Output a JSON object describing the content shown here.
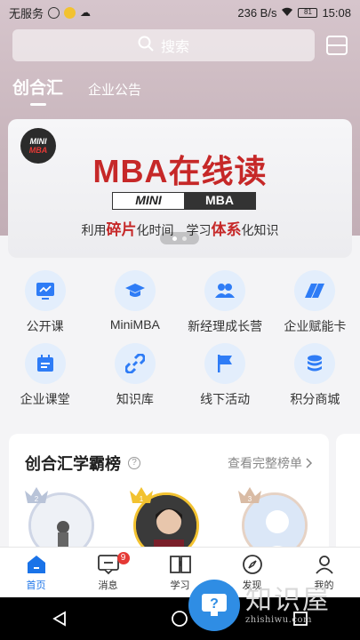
{
  "status_bar": {
    "carrier": "无服务",
    "speed": "236 B/s",
    "battery": "81",
    "time": "15:08"
  },
  "search": {
    "placeholder": "搜索"
  },
  "tabs": [
    {
      "label": "创合汇",
      "active": true
    },
    {
      "label": "企业公告",
      "active": false
    }
  ],
  "banner": {
    "logo_top": "MINI",
    "logo_bottom": "MBA",
    "title": "MBA在线读",
    "pill_left": "MINI",
    "pill_right": "MBA",
    "sub_1": "利用",
    "sub_2": "碎片",
    "sub_3": "化时间　学习",
    "sub_4": "体系",
    "sub_5": "化知识",
    "page_count": 2,
    "active_page": 1
  },
  "grid": [
    {
      "label": "公开课",
      "icon": "chart-screen-icon"
    },
    {
      "label": "MiniMBA",
      "icon": "graduation-cap-icon"
    },
    {
      "label": "新经理成长营",
      "icon": "people-icon"
    },
    {
      "label": "企业赋能卡",
      "icon": "card-icon"
    },
    {
      "label": "企业课堂",
      "icon": "calendar-icon"
    },
    {
      "label": "知识库",
      "icon": "link-icon"
    },
    {
      "label": "线下活动",
      "icon": "flag-icon"
    },
    {
      "label": "积分商城",
      "icon": "coins-icon"
    }
  ],
  "ranking": {
    "title": "创合汇学霸榜",
    "more": "查看完整榜单",
    "ranks": [
      "2",
      "1",
      "3"
    ]
  },
  "tabbar": [
    {
      "label": "首页",
      "icon": "home-icon",
      "active": true
    },
    {
      "label": "消息",
      "icon": "message-icon",
      "badge": "9"
    },
    {
      "label": "学习",
      "icon": "book-icon"
    },
    {
      "label": "发现",
      "icon": "compass-icon"
    },
    {
      "label": "我的",
      "icon": "user-icon"
    }
  ],
  "watermark": {
    "name": "知识屋",
    "url": "zhishiwu.com"
  },
  "colors": {
    "accent": "#1a73e8",
    "brand_red": "#c62828",
    "icon_bg": "#e3eefc"
  }
}
